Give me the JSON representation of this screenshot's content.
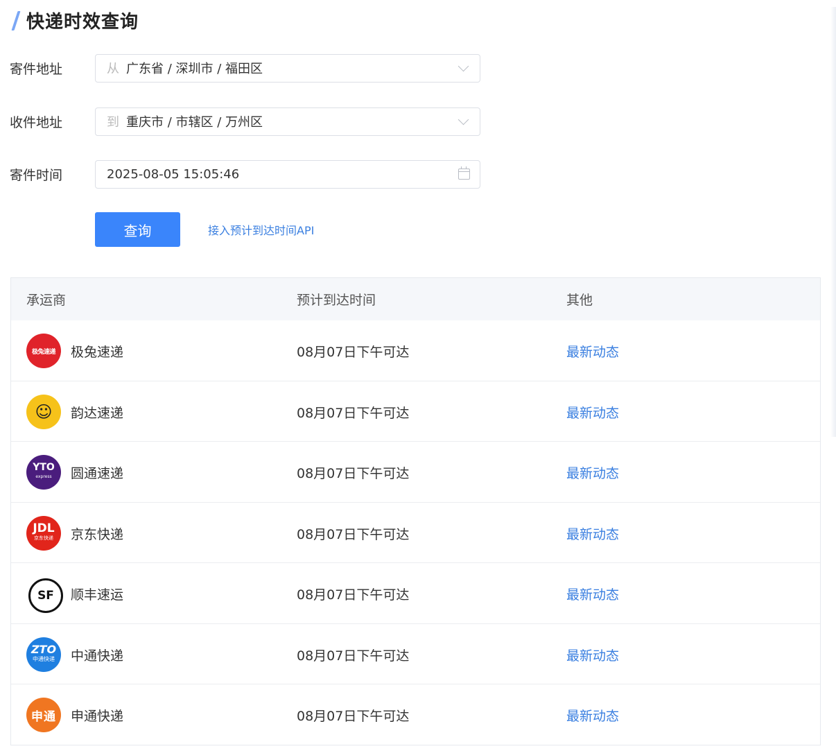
{
  "page": {
    "title": "快递时效查询"
  },
  "form": {
    "sender_label": "寄件地址",
    "sender_prefix": "从",
    "sender_value": "广东省 / 深圳市 / 福田区",
    "receiver_label": "收件地址",
    "receiver_prefix": "到",
    "receiver_value": "重庆市 / 市辖区 / 万州区",
    "time_label": "寄件时间",
    "time_value": "2025-08-05 15:05:46",
    "query_button": "查询",
    "api_link": "接入预计到达时间API"
  },
  "table": {
    "headers": [
      "承运商",
      "预计到达时间",
      "其他"
    ],
    "rows": [
      {
        "carrier": "极兔速递",
        "logo_text": "极兔速递",
        "logo_icon": "jitu-logo-icon",
        "eta": "08月07日下午可达",
        "link": "最新动态"
      },
      {
        "carrier": "韵达速递",
        "logo_text": "☺",
        "logo_icon": "yunda-logo-icon",
        "eta": "08月07日下午可达",
        "link": "最新动态"
      },
      {
        "carrier": "圆通速递",
        "logo_text": "YTO",
        "logo_sub": "express",
        "logo_icon": "yto-logo-icon",
        "eta": "08月07日下午可达",
        "link": "最新动态"
      },
      {
        "carrier": "京东快递",
        "logo_text": "JDL",
        "logo_sub": "京东快递",
        "logo_icon": "jd-logo-icon",
        "eta": "08月07日下午可达",
        "link": "最新动态"
      },
      {
        "carrier": "顺丰速运",
        "logo_text": "SF",
        "logo_icon": "sf-logo-icon",
        "eta": "08月07日下午可达",
        "link": "最新动态"
      },
      {
        "carrier": "中通快递",
        "logo_text": "ZTO",
        "logo_sub": "中通快递",
        "logo_icon": "zto-logo-icon",
        "eta": "08月07日下午可达",
        "link": "最新动态"
      },
      {
        "carrier": "申通快递",
        "logo_text": "申通",
        "logo_icon": "sto-logo-icon",
        "eta": "08月07日下午可达",
        "link": "最新动态"
      }
    ]
  },
  "colors": {
    "primary": "#3a85fb",
    "link": "#3a7fe0",
    "header_bg": "#f5f7fa",
    "title_accent": "#7ba7f5"
  }
}
